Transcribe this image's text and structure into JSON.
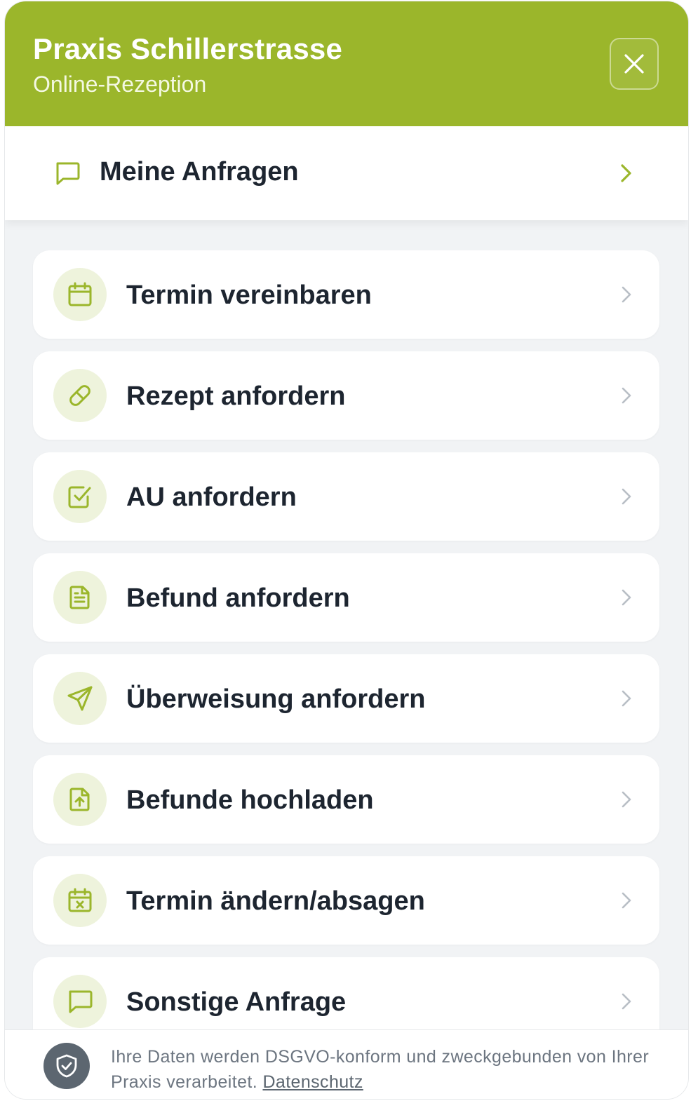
{
  "header": {
    "title": "Praxis Schillerstrasse",
    "subtitle": "Online-Rezeption",
    "close_icon": "close-icon",
    "background_color": "#9bb62b"
  },
  "my_requests": {
    "label": "Meine Anfragen",
    "icon": "chat-bubble-icon"
  },
  "menu": {
    "items": [
      {
        "label": "Termin vereinbaren",
        "icon": "calendar-icon"
      },
      {
        "label": "Rezept anfordern",
        "icon": "pill-icon"
      },
      {
        "label": "AU anfordern",
        "icon": "checkbox-icon"
      },
      {
        "label": "Befund anfordern",
        "icon": "document-icon"
      },
      {
        "label": "Überweisung anfordern",
        "icon": "send-icon"
      },
      {
        "label": "Befunde hochladen",
        "icon": "file-upload-icon"
      },
      {
        "label": "Termin ändern/absagen",
        "icon": "calendar-x-icon"
      },
      {
        "label": "Sonstige Anfrage",
        "icon": "chat-bubble-icon"
      }
    ]
  },
  "footer": {
    "privacy_text": "Ihre Daten werden DSGVO-konform und zweckgebunden von Ihrer Praxis verarbeitet.",
    "privacy_link": "Datenschutz",
    "icon": "shield-check-icon"
  },
  "colors": {
    "accent": "#9bb62b",
    "icon_bg": "#eef3dc",
    "text_primary": "#1d2530",
    "page_bg": "#f1f3f5"
  }
}
